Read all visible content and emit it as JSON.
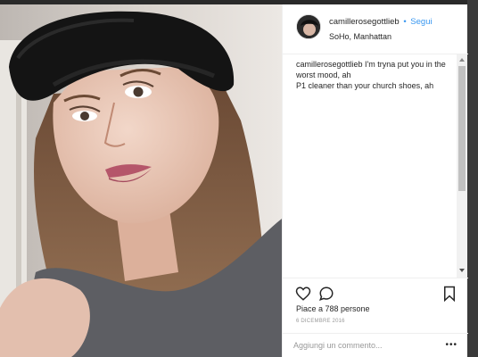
{
  "post": {
    "username": "camillerosegottlieb",
    "separator": "•",
    "follow_label": "Segui",
    "location": "SoHo, Manhattan",
    "caption_user": "camillerosegottlieb",
    "caption_line1": " I'm tryna put you in the worst mood, ah",
    "caption_line2": "P1 cleaner than your church shoes, ah",
    "likes": "Piace a 788 persone",
    "date": "6 DICEMBRE 2016",
    "comment_placeholder": "Aggiungi un commento...",
    "more_glyph": "•••"
  },
  "icons": {
    "like": "heart-icon",
    "comment": "comment-bubble-icon",
    "save": "bookmark-icon",
    "options": "more-options-icon"
  },
  "colors": {
    "link_blue": "#3897f0",
    "border": "#efefef",
    "muted_text": "#999999"
  }
}
